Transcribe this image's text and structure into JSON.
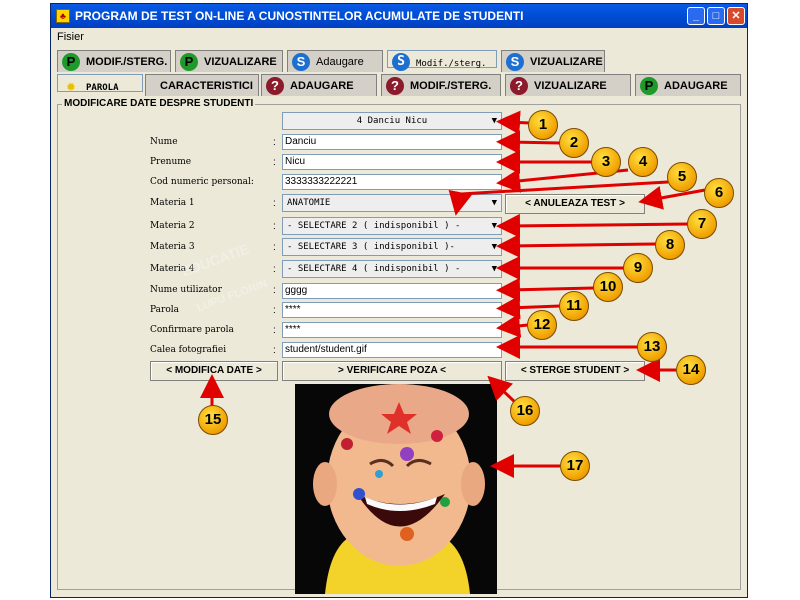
{
  "window": {
    "title": "PROGRAM DE TEST ON-LINE A CUNOSTINTELOR ACUMULATE DE STUDENTI"
  },
  "menu": {
    "file": "Fisier"
  },
  "tabs_top": [
    {
      "label": "MODIF./STERG.",
      "icon": "P"
    },
    {
      "label": "VIZUALIZARE",
      "icon": "P"
    },
    {
      "label": "Adaugare",
      "icon": "S"
    },
    {
      "label": "Modif./sterg.",
      "icon": "S"
    },
    {
      "label": "VIZUALIZARE",
      "icon": "S"
    }
  ],
  "tabs_bottom": [
    {
      "label": "PAROLA",
      "icon": "✹"
    },
    {
      "label": "CARACTERISTICI",
      "icon": ""
    },
    {
      "label": "ADAUGARE",
      "icon": "?"
    },
    {
      "label": "MODIF./STERG.",
      "icon": "?"
    },
    {
      "label": "VIZUALIZARE",
      "icon": "?"
    },
    {
      "label": "ADAUGARE",
      "icon": "P"
    }
  ],
  "form": {
    "legend": "MODIFICARE DATE DESPRE STUDENTI",
    "student_select": "4 Danciu Nicu",
    "labels": {
      "nume": "Nume",
      "prenume": "Prenume",
      "cnp": "Cod numeric personal:",
      "materia1": "Materia 1",
      "materia2": "Materia 2",
      "materia3": "Materia 3",
      "materia4": "Materia 4",
      "user": "Nume utilizator",
      "parola": "Parola",
      "confirm": "Confirmare parola",
      "cale": "Calea fotografiei"
    },
    "colon": ":",
    "values": {
      "nume": "Danciu",
      "prenume": "Nicu",
      "cnp": "3333333222221",
      "materia1": "ANATOMIE",
      "materia2": "- SELECTARE 2 ( indisponibil ) -",
      "materia3": "- SELECTARE 3 ( indisponibil )-",
      "materia4": "- SELECTARE 4 ( indisponibil ) -",
      "user": "gggg",
      "parola": "****",
      "confirm": "****",
      "cale": "student/student.gif"
    },
    "buttons": {
      "anuleaza": "< ANULEAZA TEST >",
      "modifica": "< MODIFICA DATE >",
      "verificare": ">    VERIFICARE POZA    <",
      "sterge": "< STERGE STUDENT >"
    }
  },
  "watermark": {
    "line1": "EDUCATIE",
    "line2": "LUPU FLORIN"
  },
  "callouts": [
    "1",
    "2",
    "3",
    "4",
    "5",
    "6",
    "7",
    "8",
    "9",
    "10",
    "11",
    "12",
    "13",
    "14",
    "15",
    "16",
    "17"
  ],
  "colors": {
    "arrow": "#e00000",
    "callout": "#f0a000",
    "titlebar": "#0050d8"
  }
}
